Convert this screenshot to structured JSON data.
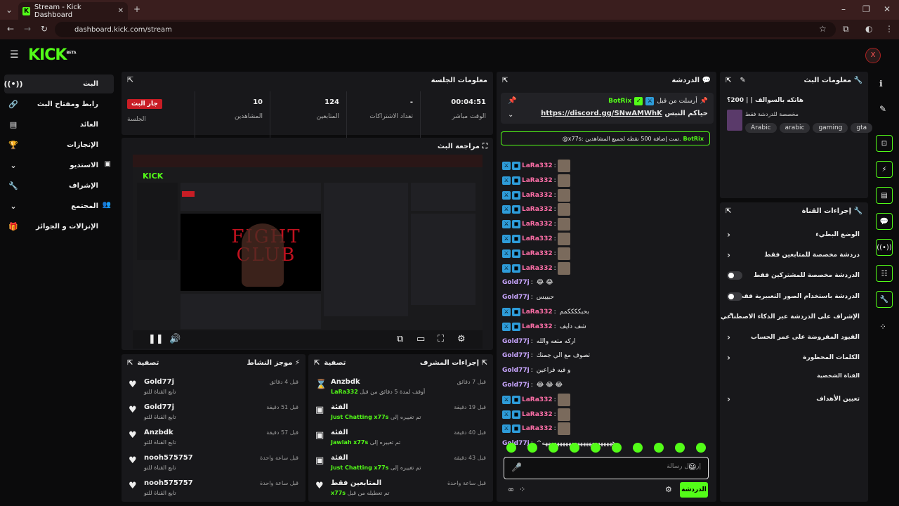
{
  "browser": {
    "tab_title": "Stream - Kick Dashboard",
    "url": "dashboard.kick.com/stream"
  },
  "header": {
    "logo": "KICK",
    "logo_sup": "BETA"
  },
  "sidebar": {
    "items": [
      {
        "label": "البث",
        "icon": "broadcast-icon"
      },
      {
        "label": "رابط ومفتاح البث",
        "icon": "link-icon"
      },
      {
        "label": "العائد",
        "icon": "chart-icon"
      },
      {
        "label": "الإنجازات",
        "icon": "trophy-icon"
      },
      {
        "label": "الاستديو",
        "icon": "studio-icon"
      },
      {
        "label": "الإشراف",
        "icon": "wrench-icon"
      },
      {
        "label": "المجتمع",
        "icon": "people-icon"
      },
      {
        "label": "الإنزالات و الجوائز",
        "icon": "gift-icon"
      }
    ]
  },
  "session": {
    "title": "معلومات الجلسة",
    "stats": [
      {
        "value": "00:04:51",
        "label": "الوقت مباشر"
      },
      {
        "value": "-",
        "label": "تعداد الاشتراكات"
      },
      {
        "value": "124",
        "label": "المتابعين"
      },
      {
        "value": "10",
        "label": "المشاهدين"
      },
      {
        "badge": "جار البث",
        "label": "الجلسة"
      }
    ]
  },
  "preview": {
    "title": "مراجعة البث",
    "film_text": "FIGHT CLUB"
  },
  "activity": {
    "title": "موجز النشاط",
    "filter": "تصفية",
    "items": [
      {
        "name": "Gold77j",
        "sub": "تابع القناة للتو",
        "time": "قبل 4 دقائق"
      },
      {
        "name": "Gold77j",
        "sub": "تابع القناة للتو",
        "time": "قبل 51 دقيقة"
      },
      {
        "name": "Anzbdk",
        "sub": "تابع القناة للتو",
        "time": "قبل 57 دقيقة"
      },
      {
        "name": "nooh575757",
        "sub": "تابع القناة للتو",
        "time": "قبل ساعة واحدة"
      },
      {
        "name": "nooh575757",
        "sub": "تابع القناة للتو",
        "time": "قبل ساعة واحدة"
      }
    ]
  },
  "modactions": {
    "title": "إجراءات المشرف",
    "filter": "تصفية",
    "items": [
      {
        "name": "Anzbdk",
        "sub": "أوقف لمدة 5 دقائق من قبل",
        "hl": "LaRa332",
        "time": "قبل 7 دقائق"
      },
      {
        "name": "الفئة",
        "sub": "تم تغييره إلى",
        "hl": "Just Chatting",
        "by": "x77s",
        "time": "قبل 19 دقيقة"
      },
      {
        "name": "الفئة",
        "sub": "تم تغييره إلى",
        "hl": "Jawlah",
        "by": "x77s",
        "time": "قبل 40 دقيقة"
      },
      {
        "name": "الفئة",
        "sub": "تم تغييره إلى",
        "hl": "Just Chatting",
        "by": "x77s",
        "time": "قبل 43 دقيقة"
      },
      {
        "name": "المتابعين فقط",
        "sub": "تم تعطيله من قبل",
        "hl": "x77s",
        "time": "قبل ساعة واحدة"
      }
    ]
  },
  "chat": {
    "title": "الدردشة",
    "pinned": {
      "label": "أرسلت من قبل",
      "user": "BotRix",
      "text": "حياكم النبس",
      "link": "https://discord.gg/SNwAMWhK"
    },
    "notice": {
      "user": "BotRix",
      "text": "@x77s: تمت إضافة 500 نقطة لجميع المشاهدين."
    },
    "messages": [
      {
        "user": "LaRa332",
        "text": "",
        "emote": true
      },
      {
        "user": "LaRa332",
        "text": "",
        "emote": true
      },
      {
        "user": "LaRa332",
        "text": "",
        "emote": true
      },
      {
        "user": "LaRa332",
        "text": "",
        "emote": true
      },
      {
        "user": "LaRa332",
        "text": "",
        "emote": true
      },
      {
        "user": "LaRa332",
        "text": "",
        "emote": true
      },
      {
        "user": "LaRa332",
        "text": "",
        "emote": true
      },
      {
        "user": "LaRa332",
        "text": "",
        "emote": true
      },
      {
        "user": "Gold77j",
        "text": "😂 😂",
        "emote": false
      },
      {
        "user": "Gold77j",
        "text": "حبيبس",
        "emote": false
      },
      {
        "user": "LaRa332",
        "text": "بحبككككمم",
        "emote": false
      },
      {
        "user": "LaRa332",
        "text": "شف دايف",
        "emote": false
      },
      {
        "user": "Gold77j",
        "text": "اركه متعه والله",
        "emote": false
      },
      {
        "user": "Gold77j",
        "text": "تصوف مع الي جمنك",
        "emote": false
      },
      {
        "user": "Gold77j",
        "text": "و فيه فراعين",
        "emote": false
      },
      {
        "user": "Gold77j",
        "text": "😂 😂 😂",
        "emote": false
      },
      {
        "user": "LaRa332",
        "text": "",
        "emote": true
      },
      {
        "user": "LaRa332",
        "text": "",
        "emote": true
      },
      {
        "user": "LaRa332",
        "text": "",
        "emote": true
      },
      {
        "user": "Gold77j",
        "text": "^ههههههههههههههههههههههههه",
        "emote": false
      }
    ],
    "input_placeholder": "إرسال رسالة",
    "send_label": "الدردشة"
  },
  "streaminfo": {
    "title": "معلومات البث",
    "stream_title": "هاتكه بالسوالف | | 200؟",
    "category": "مخصصة للدردشة فقط",
    "tags": [
      "Arabic",
      "arabic",
      "gaming",
      "gta"
    ]
  },
  "channelactions": {
    "title": "إجراءات القناة",
    "rows": [
      {
        "label": "الوضع البطيء",
        "kind": "chevron"
      },
      {
        "label": "دردشة مخصصة للمتابعين فقط",
        "kind": "chevron"
      },
      {
        "label": "الدردشة مخصصة للمشتركين فقط",
        "kind": "toggle"
      },
      {
        "label": "الدردشة باستخدام الصور التعبيرية فقط",
        "kind": "toggle"
      },
      {
        "label": "الإشراف على الدردشة عبر الذكاء الاصطناعي",
        "kind": "external"
      },
      {
        "label": "القيود المفروضة على عمر الحساب",
        "kind": "chevron"
      },
      {
        "label": "الكلمات المحظورة",
        "kind": "chevron"
      },
      {
        "label": "القناة الشخصية",
        "kind": "heading"
      },
      {
        "label": "تعيين الأهداف",
        "kind": "chevron"
      }
    ]
  },
  "colors": {
    "accent": "#53fc18",
    "live": "#c81d25",
    "mod_badge": "#2e9cd9",
    "lara": "#ff6fa8",
    "gold": "#c9a6ff"
  }
}
